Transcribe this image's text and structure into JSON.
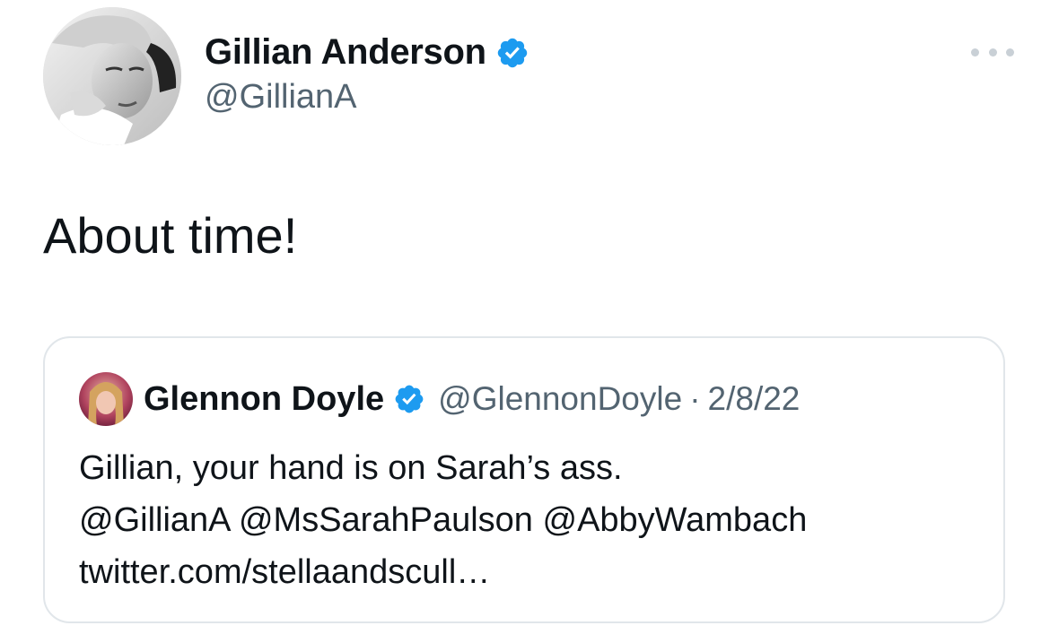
{
  "author": {
    "display_name": "Gillian Anderson",
    "handle": "@GillianA",
    "verified": true
  },
  "tweet": {
    "text": "About time!"
  },
  "quoted_tweet": {
    "display_name": "Glennon Doyle",
    "handle": "@GlennonDoyle",
    "separator": "·",
    "date": "2/8/22",
    "verified": true,
    "lines": [
      "Gillian, your hand is on Sarah’s ass.",
      "@GillianA @MsSarahPaulson @AbbyWambach",
      "twitter.com/stellaandscull…"
    ]
  },
  "icons": {
    "verified": "verified-badge-icon",
    "more": "more-options-icon"
  },
  "colors": {
    "verified_blue": "#1d9bf0",
    "secondary_text": "#536471",
    "primary_text": "#0f1419",
    "border": "#e1e6ea"
  }
}
